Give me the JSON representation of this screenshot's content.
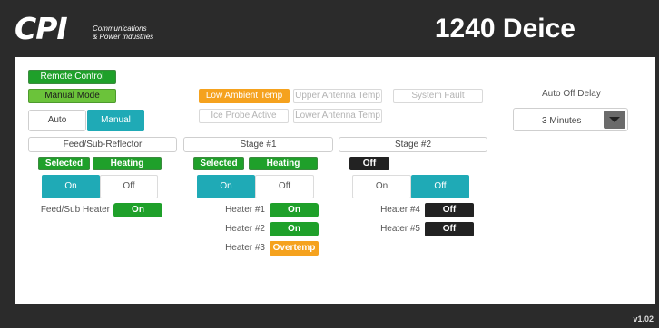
{
  "header": {
    "logo_mark": "CPI",
    "logo_line1": "Communications",
    "logo_line2": "& Power Industries",
    "title": "1240 Deice"
  },
  "controls": {
    "remote_control": "Remote Control",
    "manual_mode": "Manual Mode",
    "auto": "Auto",
    "manual": "Manual"
  },
  "alarms": {
    "low_ambient_temp": "Low Ambient Temp",
    "upper_antenna_temp": "Upper Antenna Temp",
    "system_fault": "System Fault",
    "ice_probe_active": "Ice Probe Active",
    "lower_antenna_temp": "Lower Antenna Temp"
  },
  "auto_off_delay": {
    "label": "Auto Off Delay",
    "selected": "3 Minutes",
    "icon": "chevron-down-icon"
  },
  "feed": {
    "title": "Feed/Sub-Reflector",
    "selected": "Selected",
    "heating": "Heating",
    "on": "On",
    "off": "Off",
    "heater_label": "Feed/Sub Heater",
    "heater_state": "On"
  },
  "stage1": {
    "title": "Stage #1",
    "selected": "Selected",
    "heating": "Heating",
    "on": "On",
    "off": "Off",
    "heaters": [
      {
        "label": "Heater #1",
        "state": "On"
      },
      {
        "label": "Heater #2",
        "state": "On"
      },
      {
        "label": "Heater #3",
        "state": "Overtemp"
      }
    ]
  },
  "stage2": {
    "title": "Stage #2",
    "status": "Off",
    "on": "On",
    "off": "Off",
    "heaters": [
      {
        "label": "Heater #4",
        "state": "Off"
      },
      {
        "label": "Heater #5",
        "state": "Off"
      }
    ]
  },
  "footer": {
    "version": "v1.02"
  },
  "colors": {
    "green": "#1fa02a",
    "mode_green": "#6bc33a",
    "orange": "#f5a21e",
    "teal": "#1faab6",
    "dark": "#222222",
    "chrome": "#2b2b2b"
  }
}
